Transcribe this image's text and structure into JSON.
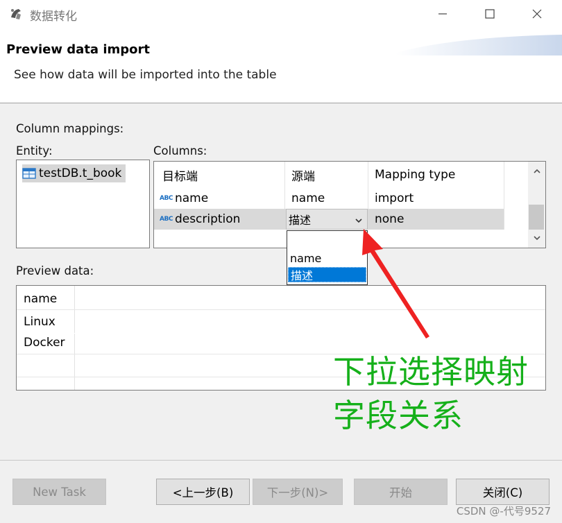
{
  "window": {
    "title": "数据转化",
    "controls": {
      "minimize_icon": "minimize-icon",
      "maximize_icon": "maximize-icon",
      "close_icon": "close-icon"
    }
  },
  "header": {
    "title": "Preview data import",
    "subtitle": "See how data will be imported into the table"
  },
  "mappings": {
    "section_label": "Column mappings:",
    "entity_label": "Entity:",
    "columns_label": "Columns:",
    "entities": [
      {
        "name": "testDB.t_book",
        "icon": "table-icon"
      }
    ],
    "columns_header": {
      "target": "目标端",
      "source": "源端",
      "mapping_type": "Mapping type"
    },
    "rows": [
      {
        "target": "name",
        "target_icon": "text-type-icon",
        "source": "name",
        "mapping_type": "import"
      },
      {
        "target": "description",
        "target_icon": "text-type-icon",
        "source": "描述",
        "mapping_type": "none"
      }
    ],
    "dropdown": {
      "options": [
        "",
        "name",
        "描述"
      ],
      "selected": "描述"
    }
  },
  "preview": {
    "label": "Preview data:",
    "header": "name",
    "rows": [
      "Linux",
      "Docker",
      "",
      ""
    ]
  },
  "annotation": {
    "line1": "下拉选择映射",
    "line2": "字段关系",
    "color": "#15b01a",
    "arrow_color": "#ee2222"
  },
  "buttons": {
    "new_task": "New Task",
    "prev": "<上一步(B)",
    "next": "下一步(N)>",
    "start": "开始",
    "close": "关闭(C)"
  },
  "watermark": "CSDN @-代号9527"
}
